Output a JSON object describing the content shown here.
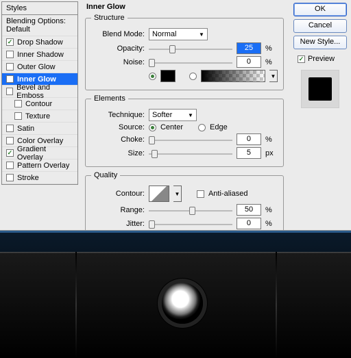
{
  "left": {
    "title": "Styles",
    "blending": "Blending Options: Default",
    "items": [
      {
        "label": "Drop Shadow",
        "checked": true,
        "selected": false
      },
      {
        "label": "Inner Shadow",
        "checked": false,
        "selected": false
      },
      {
        "label": "Outer Glow",
        "checked": false,
        "selected": false
      },
      {
        "label": "Inner Glow",
        "checked": true,
        "selected": true
      },
      {
        "label": "Bevel and Emboss",
        "checked": false,
        "selected": false
      },
      {
        "label": "Contour",
        "checked": false,
        "selected": false,
        "indent": true
      },
      {
        "label": "Texture",
        "checked": false,
        "selected": false,
        "indent": true
      },
      {
        "label": "Satin",
        "checked": false,
        "selected": false
      },
      {
        "label": "Color Overlay",
        "checked": false,
        "selected": false
      },
      {
        "label": "Gradient Overlay",
        "checked": true,
        "selected": false
      },
      {
        "label": "Pattern Overlay",
        "checked": false,
        "selected": false
      },
      {
        "label": "Stroke",
        "checked": false,
        "selected": false
      }
    ]
  },
  "main": {
    "title": "Inner Glow",
    "structure": {
      "legend": "Structure",
      "blend_label": "Blend Mode:",
      "blend_value": "Normal",
      "opacity_label": "Opacity:",
      "opacity_value": "25",
      "opacity_unit": "%",
      "noise_label": "Noise:",
      "noise_value": "0",
      "noise_unit": "%",
      "color": "#000000"
    },
    "elements": {
      "legend": "Elements",
      "tech_label": "Technique:",
      "tech_value": "Softer",
      "source_label": "Source:",
      "source_center": "Center",
      "source_edge": "Edge",
      "choke_label": "Choke:",
      "choke_value": "0",
      "choke_unit": "%",
      "size_label": "Size:",
      "size_value": "5",
      "size_unit": "px"
    },
    "quality": {
      "legend": "Quality",
      "contour_label": "Contour:",
      "aa_label": "Anti-aliased",
      "range_label": "Range:",
      "range_value": "50",
      "range_unit": "%",
      "jitter_label": "Jitter:",
      "jitter_value": "0",
      "jitter_unit": "%"
    }
  },
  "right": {
    "ok": "OK",
    "cancel": "Cancel",
    "new_style": "New Style...",
    "preview": "Preview"
  }
}
